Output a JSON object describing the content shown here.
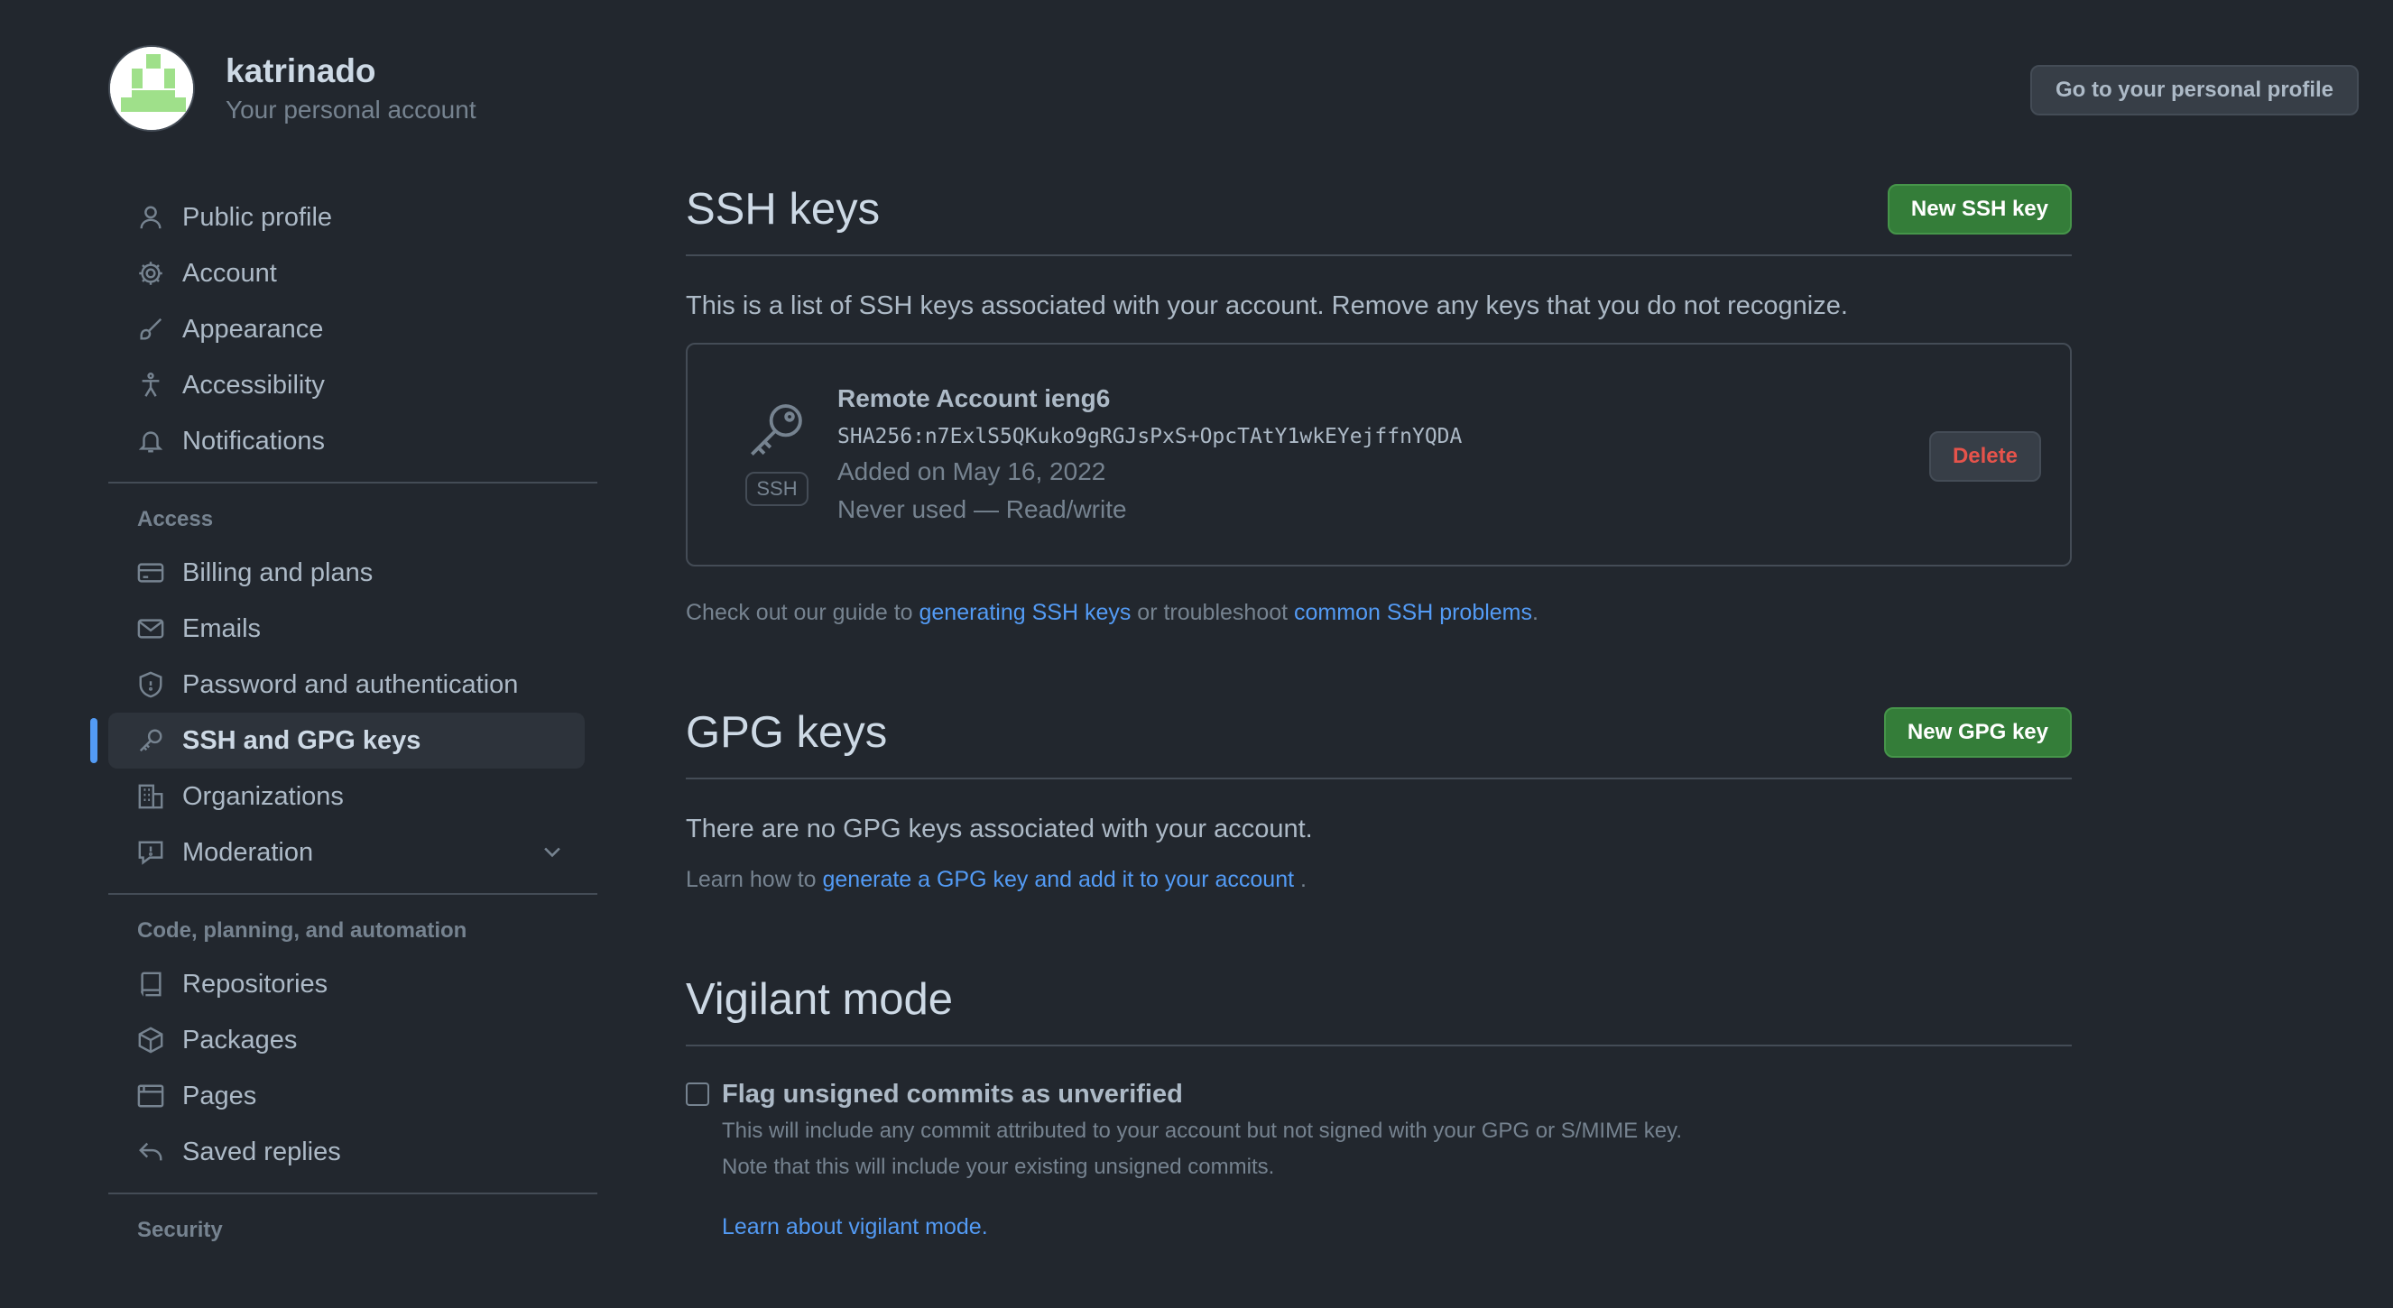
{
  "header": {
    "username": "katrinado",
    "subtitle": "Your personal account",
    "profile_button": "Go to your personal profile"
  },
  "sidebar": {
    "items_top": [
      {
        "label": "Public profile",
        "icon": "person-icon"
      },
      {
        "label": "Account",
        "icon": "gear-icon"
      },
      {
        "label": "Appearance",
        "icon": "paintbrush-icon"
      },
      {
        "label": "Accessibility",
        "icon": "accessibility-icon"
      },
      {
        "label": "Notifications",
        "icon": "bell-icon"
      }
    ],
    "access_label": "Access",
    "items_access": [
      {
        "label": "Billing and plans",
        "icon": "credit-card-icon"
      },
      {
        "label": "Emails",
        "icon": "mail-icon"
      },
      {
        "label": "Password and authentication",
        "icon": "shield-icon"
      },
      {
        "label": "SSH and GPG keys",
        "icon": "key-icon",
        "active": true
      },
      {
        "label": "Organizations",
        "icon": "organization-icon"
      },
      {
        "label": "Moderation",
        "icon": "report-icon"
      }
    ],
    "code_label": "Code, planning, and automation",
    "items_code": [
      {
        "label": "Repositories",
        "icon": "repo-icon"
      },
      {
        "label": "Packages",
        "icon": "package-icon"
      },
      {
        "label": "Pages",
        "icon": "browser-icon"
      },
      {
        "label": "Saved replies",
        "icon": "reply-icon"
      }
    ],
    "security_label": "Security"
  },
  "ssh": {
    "title": "SSH keys",
    "new_button": "New SSH key",
    "intro": "This is a list of SSH keys associated with your account. Remove any keys that you do not recognize.",
    "key": {
      "badge": "SSH",
      "name": "Remote Account ieng6",
      "fingerprint": "SHA256:n7ExlS5QKuko9gRGJsPxS+OpcTAtY1wkEYejffnYQDA",
      "added": "Added on May 16, 2022",
      "usage": "Never used — Read/write",
      "delete_button": "Delete"
    },
    "guide": {
      "prefix": "Check out our guide to ",
      "link1": "generating SSH keys",
      "middle": " or troubleshoot ",
      "link2": "common SSH problems",
      "suffix": "."
    }
  },
  "gpg": {
    "title": "GPG keys",
    "new_button": "New GPG key",
    "empty": "There are no GPG keys associated with your account.",
    "learn_prefix": "Learn how to ",
    "learn_link": "generate a GPG key and add it to your account",
    "learn_suffix": " ."
  },
  "vigilant": {
    "title": "Vigilant mode",
    "checkbox_label": "Flag unsigned commits as unverified",
    "checked": false,
    "desc1": "This will include any commit attributed to your account but not signed with your GPG or S/MIME key.",
    "desc2": "Note that this will include your existing unsigned commits.",
    "link": "Learn about vigilant mode",
    "link_suffix": "."
  },
  "colors": {
    "background": "#22272e",
    "accent": "#539bf5",
    "green": "#347d39",
    "danger": "#e5534b"
  }
}
